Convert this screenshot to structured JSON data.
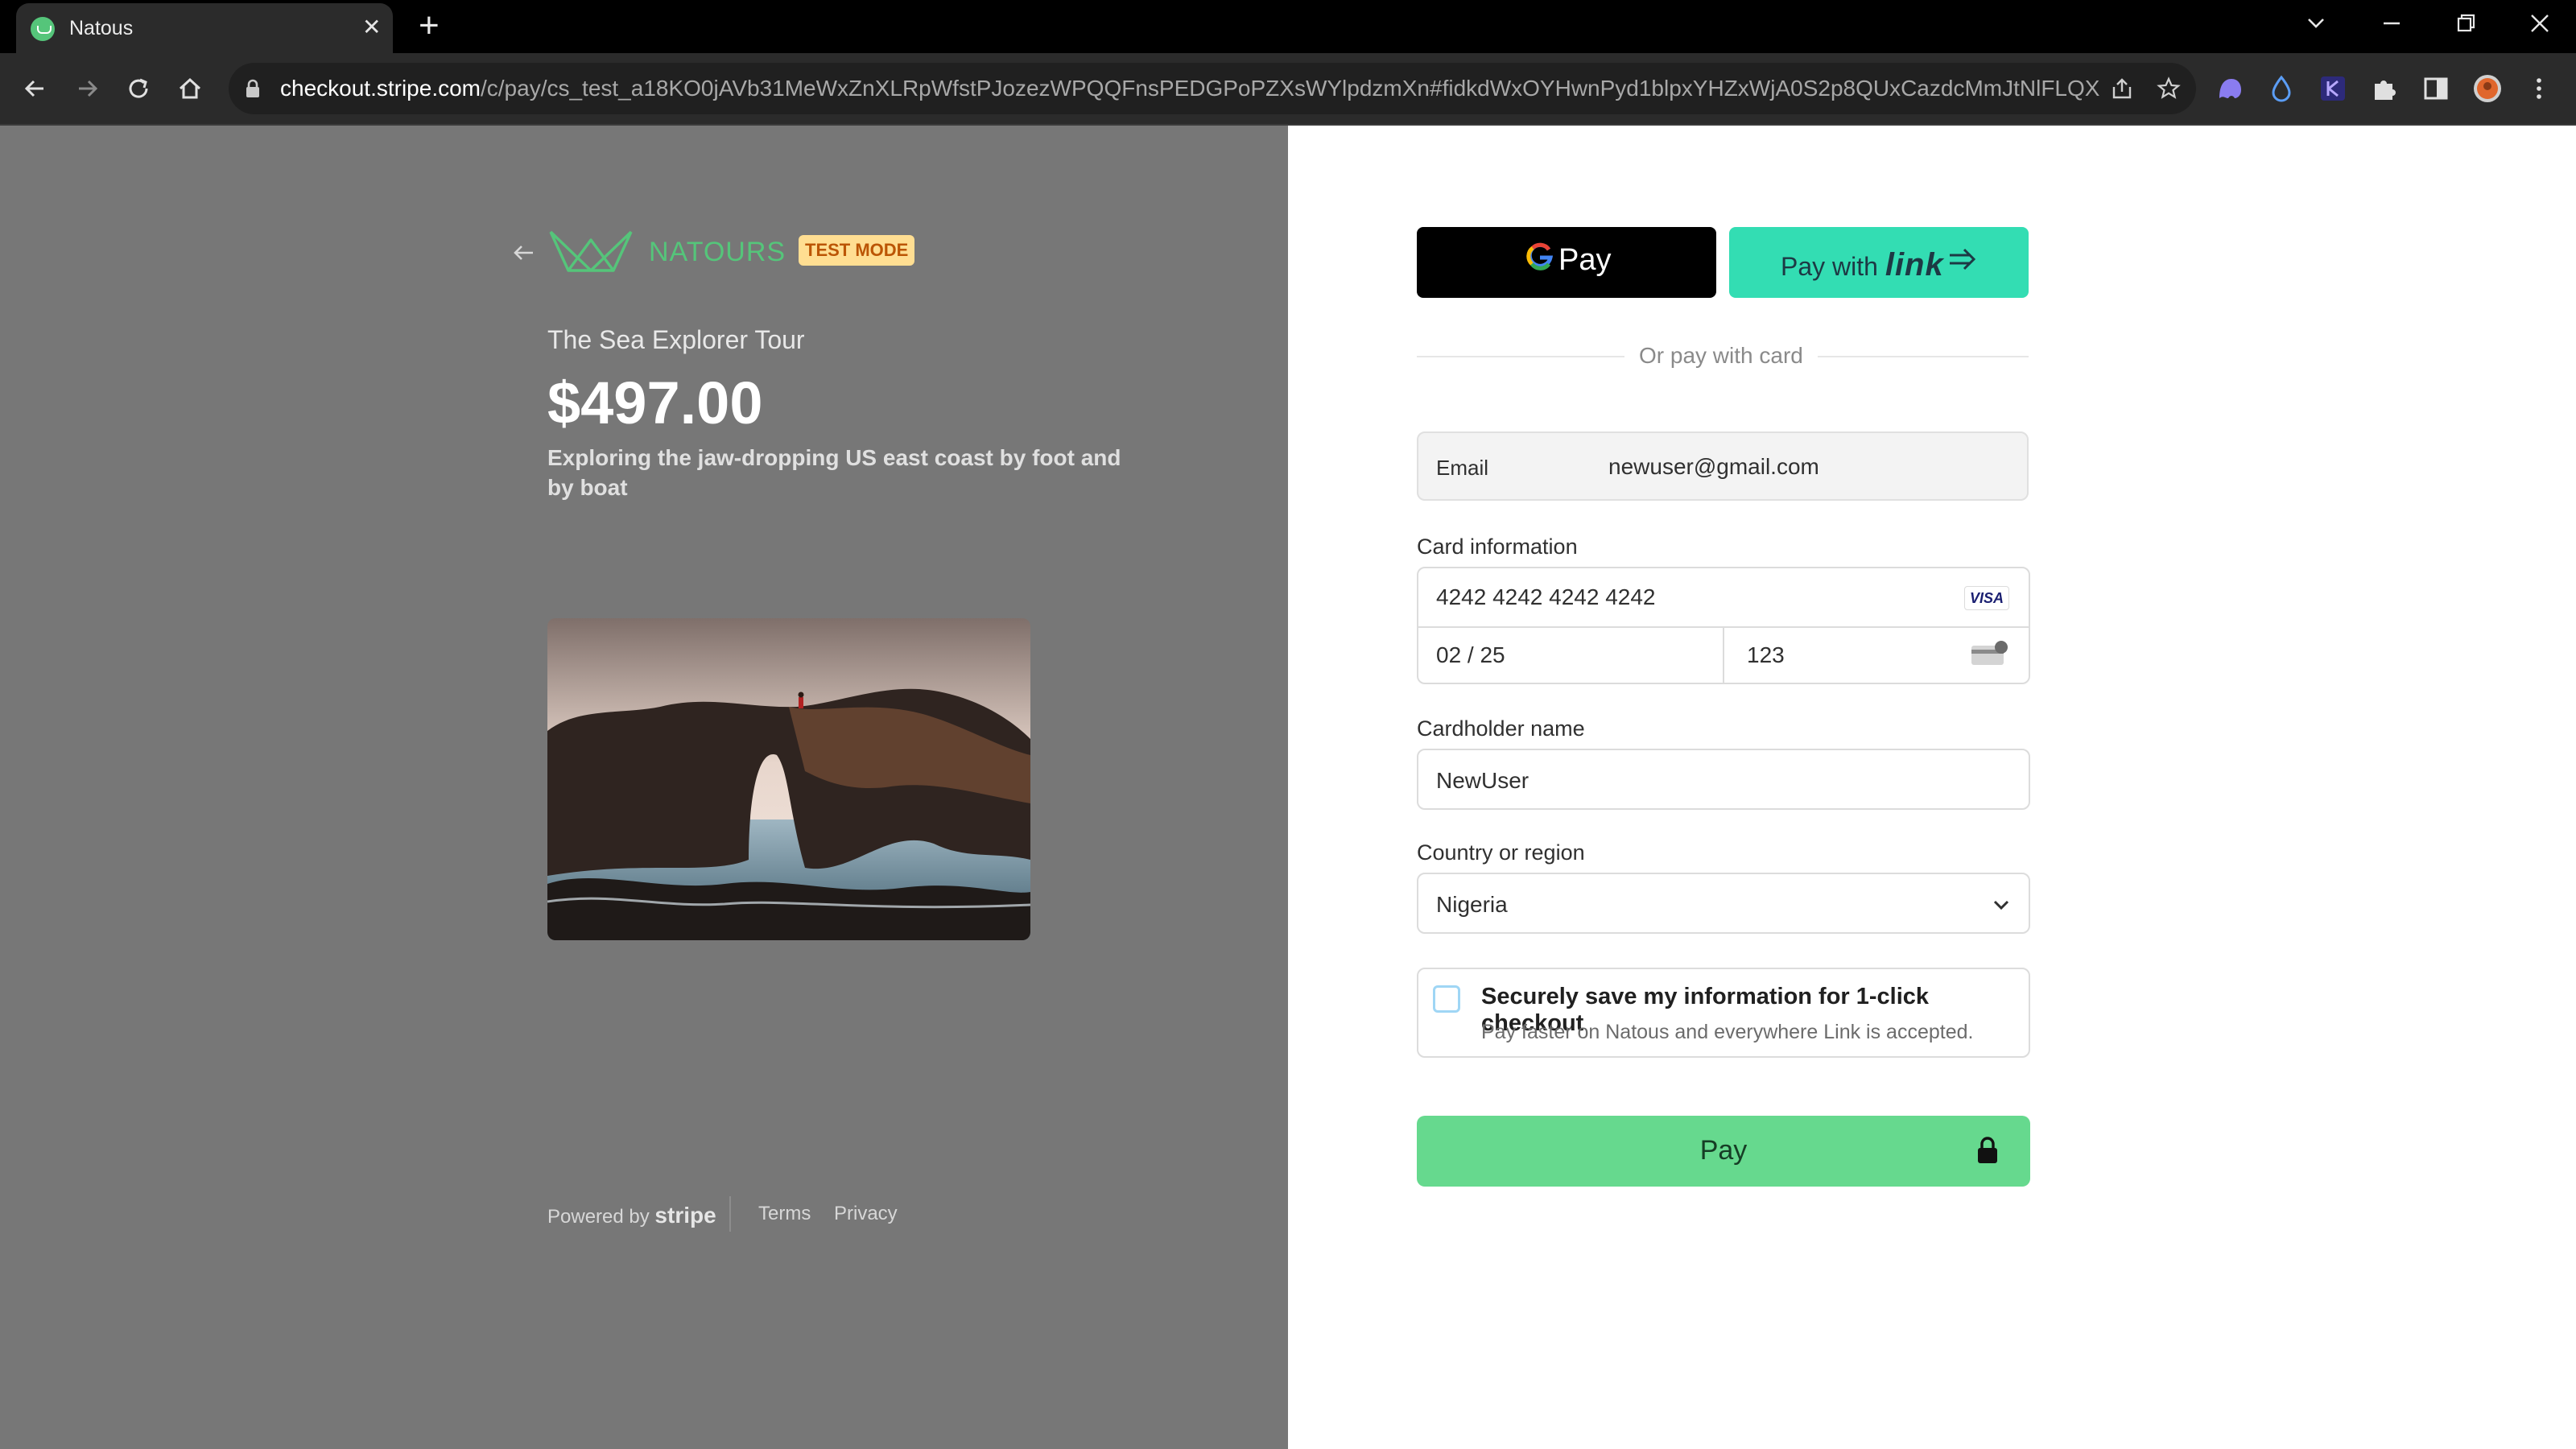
{
  "browser": {
    "tab_title": "Natous",
    "tab_close": "✕",
    "new_tab": "+",
    "url_host": "checkout.stripe.com",
    "url_path": "/c/pay/cs_test_a18KO0jAVb31MeWxZnXLRpWfstPJozezWPQQFnsPEDGPoPZXsWYlpdzmXn#fidkdWxOYHwnPyd1blpxYHZxWjA0S2p8QUxCazdcMmJtNlFLQXFSTE..."
  },
  "checkout": {
    "brand_name": "NATOURS",
    "test_mode": "TEST MODE",
    "product_name": "The Sea Explorer Tour",
    "price": "$497.00",
    "description": "Exploring the jaw-dropping US east coast by foot and by boat",
    "footer": {
      "powered_by": "Powered by",
      "stripe": "stripe",
      "terms": "Terms",
      "privacy": "Privacy"
    },
    "gpay_label": "Pay",
    "link_prefix": "Pay with",
    "link_word": "link",
    "divider_text": "Or pay with card",
    "email_label": "Email",
    "email_value": "newuser@gmail.com",
    "card_info_label": "Card information",
    "card_number": "4242 4242 4242 4242",
    "card_brand": "VISA",
    "expiry": "02 / 25",
    "cvc": "123",
    "cardholder_label": "Cardholder name",
    "cardholder_value": "NewUser",
    "country_label": "Country or region",
    "country_value": "Nigeria",
    "save_title": "Securely save my information for 1-click checkout",
    "save_subtitle": "Pay faster on Natous and everywhere Link is accepted.",
    "pay_button": "Pay"
  },
  "colors": {
    "brand_green": "#55c57a",
    "link_teal": "#33ddb3",
    "pay_green": "#66d98e",
    "left_panel_bg": "#777777"
  }
}
